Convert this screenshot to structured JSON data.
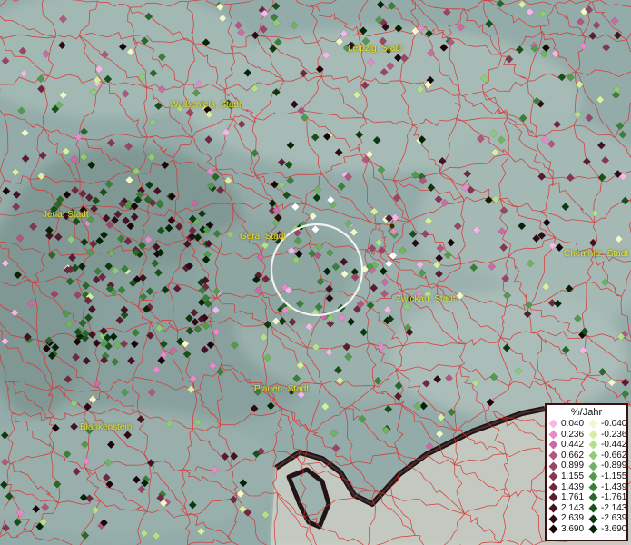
{
  "map": {
    "cities": [
      {
        "name": "Leipzig, Stadt"
      },
      {
        "name": "Weißenfels, Stadt"
      },
      {
        "name": "Jena, Stadt"
      },
      {
        "name": "Gera, Stadt"
      },
      {
        "name": "Chemnitz, Stadt"
      },
      {
        "name": "Zwickau, Stadt"
      },
      {
        "name": "Plauen, Stadt"
      },
      {
        "name": "Blankenstein"
      }
    ],
    "colors": {
      "boundaries": "#d83030",
      "highlight_circle": "#f2f2f2"
    }
  },
  "legend": {
    "title": "%/Jahr",
    "positive": [
      {
        "value": "0.040",
        "color": "#f4b8e8"
      },
      {
        "value": "0.236",
        "color": "#e48cc8"
      },
      {
        "value": "0.442",
        "color": "#cc6aa4"
      },
      {
        "value": "0.662",
        "color": "#b25682"
      },
      {
        "value": "0.899",
        "color": "#9a4466"
      },
      {
        "value": "1.155",
        "color": "#843652"
      },
      {
        "value": "1.439",
        "color": "#702840"
      },
      {
        "value": "1.761",
        "color": "#5a1c2e"
      },
      {
        "value": "2.143",
        "color": "#441220"
      },
      {
        "value": "2.639",
        "color": "#2e0a14"
      },
      {
        "value": "3.690",
        "color": "#1a0408"
      }
    ],
    "negative": [
      {
        "value": "-0.040",
        "color": "#f2f8c8"
      },
      {
        "value": "-0.236",
        "color": "#d6f0a0"
      },
      {
        "value": "-0.442",
        "color": "#b4e08a"
      },
      {
        "value": "-0.662",
        "color": "#90cc76"
      },
      {
        "value": "-0.899",
        "color": "#70b462"
      },
      {
        "value": "-1.155",
        "color": "#529a4c"
      },
      {
        "value": "-1.439",
        "color": "#3a8038"
      },
      {
        "value": "-1.761",
        "color": "#286828"
      },
      {
        "value": "-2.143",
        "color": "#18501a"
      },
      {
        "value": "-2.639",
        "color": "#0c3a10"
      },
      {
        "value": "-3.690",
        "color": "#042406"
      }
    ]
  }
}
